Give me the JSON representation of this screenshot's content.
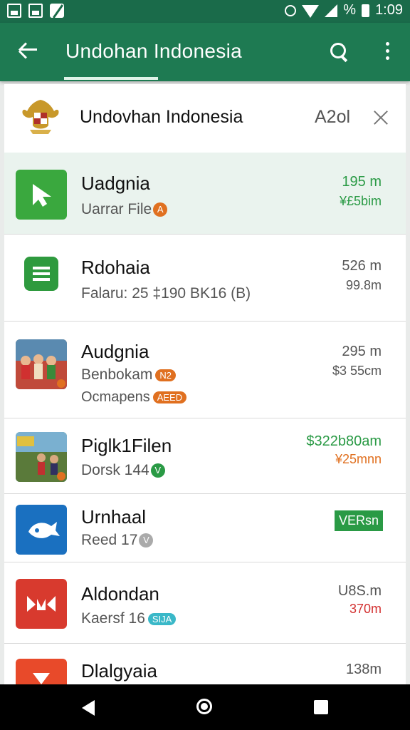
{
  "status_bar": {
    "battery_pct": "%",
    "time": "1:09"
  },
  "app_bar": {
    "title": "Undohan Indonesia"
  },
  "header": {
    "title": "Undovhan Indonesia",
    "aux": "A2ol"
  },
  "colors": {
    "brand": "#1e7a52",
    "accent_green": "#2a9a45",
    "accent_orange": "#e07020",
    "accent_red": "#d33030"
  },
  "items": [
    {
      "name": "Uadgnia",
      "sub": "Uarrar File",
      "badge": "A",
      "val1": "195 m",
      "val2": "¥£5bim",
      "icon": "green-arrow-icon"
    },
    {
      "name": "Rdohaia",
      "sub": "Falaru: 25 ‡190 BK16 (B)",
      "val1": "526 m",
      "val2": "99.8m",
      "icon": "green-list-icon"
    },
    {
      "name": "Audgnia",
      "sub": "Benbokam",
      "badge": "N2",
      "sub2": "Ocmapens",
      "badge2": "AEED",
      "val1": "295 m",
      "val2": "$3 55cm",
      "icon": "photo-people-icon"
    },
    {
      "name": "Piglk1Filen",
      "sub": "Dorsk 144",
      "badge": "V",
      "val1": "$322b80am",
      "val2": "¥25mnn",
      "icon": "photo-market-icon"
    },
    {
      "name": "Urnhaal",
      "sub": "Reed 17",
      "badge": "V",
      "pill": "VERsn",
      "icon": "blue-fish-icon"
    },
    {
      "name": "Aldondan",
      "sub": "Kaersf 16",
      "badge": "SIJA",
      "val1": "U8S.m",
      "val2": "370m",
      "icon": "red-m-icon"
    },
    {
      "name": "Dlalgyaia",
      "val1": "138m",
      "icon": "red-shape-icon"
    }
  ]
}
